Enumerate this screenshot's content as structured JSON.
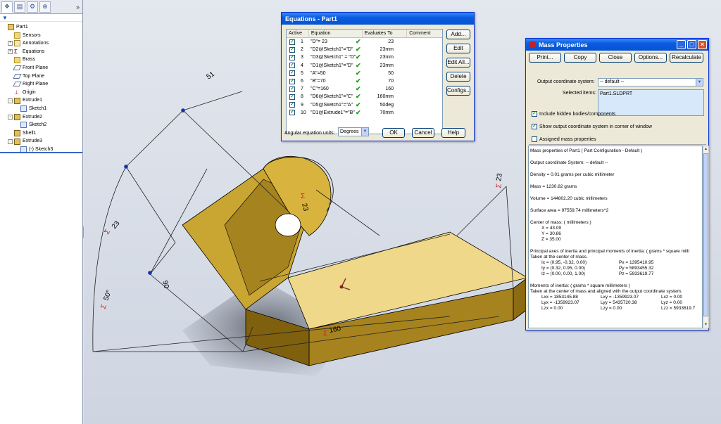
{
  "feature_manager": {
    "expand_glyph": "»",
    "filter_glyph": "▼",
    "tree": [
      {
        "label": "Part1",
        "icon": "part-icon",
        "level": 0,
        "expander": ""
      },
      {
        "label": "Sensors",
        "icon": "folder-icon",
        "level": 1,
        "expander": ""
      },
      {
        "label": "Annotations",
        "icon": "annotations-icon",
        "level": 1,
        "expander": "+"
      },
      {
        "label": "Equations",
        "icon": "equations-icon",
        "level": 1,
        "expander": "+"
      },
      {
        "label": "Brass",
        "icon": "material-icon",
        "level": 1,
        "expander": ""
      },
      {
        "label": "Front Plane",
        "icon": "plane-icon",
        "level": 1,
        "expander": ""
      },
      {
        "label": "Top Plane",
        "icon": "plane-icon",
        "level": 1,
        "expander": ""
      },
      {
        "label": "Right Plane",
        "icon": "plane-icon",
        "level": 1,
        "expander": ""
      },
      {
        "label": "Origin",
        "icon": "origin-icon",
        "level": 1,
        "expander": ""
      },
      {
        "label": "Extrude1",
        "icon": "feature-icon",
        "level": 1,
        "expander": "-"
      },
      {
        "label": "Sketch1",
        "icon": "sketch-icon",
        "level": 2,
        "expander": ""
      },
      {
        "label": "Extrude2",
        "icon": "feature-icon",
        "level": 1,
        "expander": "-"
      },
      {
        "label": "Sketch2",
        "icon": "sketch-icon",
        "level": 2,
        "expander": ""
      },
      {
        "label": "Shell1",
        "icon": "feature-icon",
        "level": 1,
        "expander": ""
      },
      {
        "label": "Extrude3",
        "icon": "feature-icon",
        "level": 1,
        "expander": "-"
      },
      {
        "label": "(-) Sketch3",
        "icon": "sketch-icon",
        "level": 2,
        "expander": ""
      }
    ]
  },
  "viewport": {
    "dims": {
      "d51": "51",
      "d23a": "23",
      "d23b": "23",
      "d23c": "23",
      "d50": "50°",
      "d90": "90",
      "d160": "160"
    },
    "sigma": "Σ"
  },
  "equations": {
    "title": "Equations - Part1",
    "columns": {
      "active": "Active",
      "equation": "Equation",
      "evaluates": "Evaluates To",
      "comment": "Comment"
    },
    "rows": [
      {
        "index": "1",
        "equation": "\"D\"= 23",
        "value": "23"
      },
      {
        "index": "2",
        "equation": "\"D2@Sketch1\"=\"D\"",
        "value": "23mm"
      },
      {
        "index": "3",
        "equation": "\"D3@Sketch1\" = \"D\"",
        "value": "23mm"
      },
      {
        "index": "4",
        "equation": "\"D1@Sketch1\"=\"D\"",
        "value": "23mm"
      },
      {
        "index": "5",
        "equation": "\"A\"=50",
        "value": "50"
      },
      {
        "index": "6",
        "equation": "\"B\"=70",
        "value": "70"
      },
      {
        "index": "7",
        "equation": "\"C\"=160",
        "value": "160"
      },
      {
        "index": "8",
        "equation": "\"D6@Sketch1\"=\"C\"",
        "value": "160mm"
      },
      {
        "index": "9",
        "equation": "\"D5@Sketch1\"=\"A\"",
        "value": "50deg"
      },
      {
        "index": "10",
        "equation": "\"D1@Extrude1\"=\"B\"",
        "value": "70mm"
      }
    ],
    "buttons": {
      "add": "Add...",
      "edit": "Edit",
      "edit_all": "Edit All...",
      "delete": "Delete",
      "configs": "Configs...",
      "ok": "OK",
      "cancel": "Cancel",
      "help": "Help"
    },
    "units_label": "Angular equation units:",
    "units_value": "Degrees",
    "check_glyph": "✓",
    "ok_glyph": "✔"
  },
  "mass": {
    "title": "Mass Properties",
    "buttons": {
      "print": "Print...",
      "copy": "Copy",
      "close": "Close",
      "options": "Options...",
      "recalculate": "Recalculate"
    },
    "coord_label": "Output coordinate system:",
    "coord_value": "-- default --",
    "selected_label": "Selected items:",
    "selected_value": "Part1.SLDPRT",
    "checks": [
      {
        "label": "Include hidden bodies/components",
        "checked": true
      },
      {
        "label": "Show output coordinate system in corner of window",
        "checked": true
      },
      {
        "label": "Assigned mass properties",
        "checked": false
      }
    ],
    "report": [
      "Mass properties of Part1 ( Part Configuration - Default )",
      "Output  coordinate System: -- default --",
      "Density = 0.01 grams per cubic millimeter",
      "Mass = 1230.82 grams",
      "Volume = 144802.20 cubic millimeters",
      "Surface area = 97559.74 millimeters^2",
      "Center of mass: ( millimeters )",
      "X = 43.09",
      "Y = 30.86",
      "Z = 35.00",
      "Principal axes of inertia and principal moments of inertia: ( grams * square milli",
      "Taken at the center of mass.",
      "Ix = (0.95, -0.32, 0.00)",
      "Px = 1395410.95",
      "Iy = (0.32, 0.95, 0.00)",
      "Py = 5893455.32",
      "Iz = (0.00, 0.00, 1.00)",
      "Pz = 5933619.77",
      "Moments of inertia: ( grams * square millimeters )",
      "Taken at the center of mass and aligned with the output coordinate system.",
      "Lxx = 1853145.88",
      "Lxy = -1359923.07",
      "Lxz = 0.00",
      "Lyx = -1359923.07",
      "Lyy = 5435720.38",
      "Lyz = 0.00",
      "Lzx = 0.00",
      "Lzy = 0.00",
      "Lzz = 5933619.7"
    ]
  },
  "colors": {
    "titlebar": "#0553d4",
    "part_face": "#c9a532",
    "part_top": "#f0d88a",
    "dialog_bg": "#ece9d8"
  }
}
